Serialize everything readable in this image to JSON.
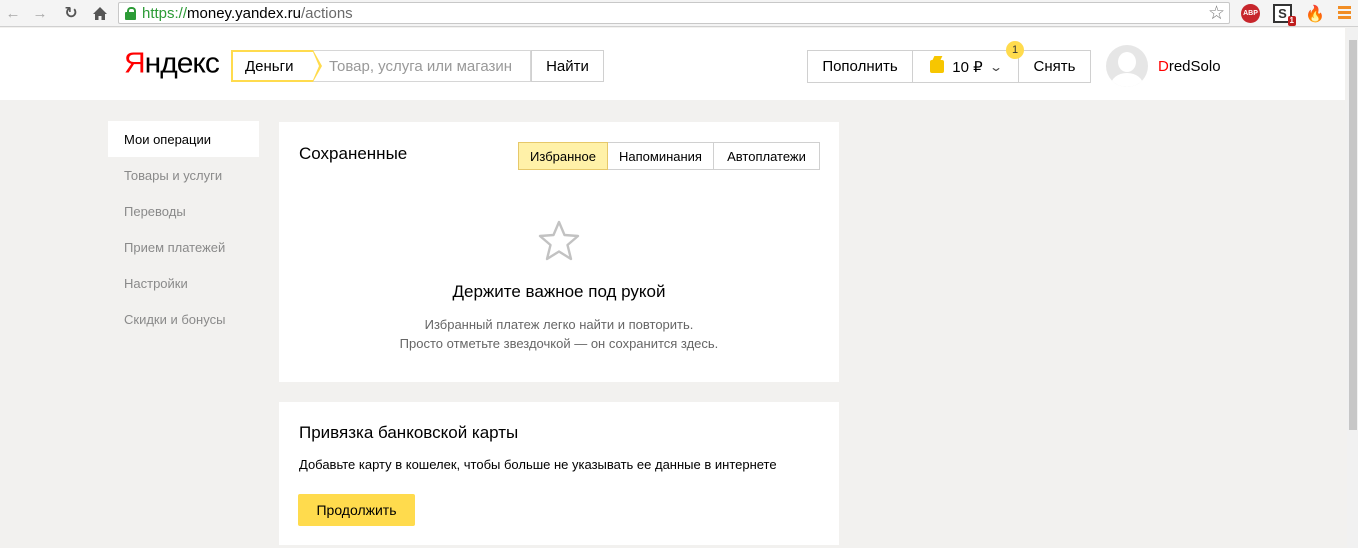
{
  "browser": {
    "url_scheme": "https://",
    "url_host": "money.yandex.ru",
    "url_path": "/actions",
    "ext_badge": "1",
    "abp_label": "ABP",
    "s_label": "S"
  },
  "header": {
    "logo_first": "Я",
    "logo_rest": "ндекс",
    "service_tab": "Деньги",
    "search_placeholder": "Товар, услуга или магазин",
    "search_button": "Найти",
    "topup_button": "Пополнить",
    "balance": "10 ₽",
    "withdraw_button": "Снять",
    "notification_count": "1",
    "username_first": "D",
    "username_rest": "redSolo"
  },
  "sidebar": {
    "items": [
      {
        "label": "Мои операции"
      },
      {
        "label": "Товары и услуги"
      },
      {
        "label": "Переводы"
      },
      {
        "label": "Прием платежей"
      },
      {
        "label": "Настройки"
      },
      {
        "label": "Скидки и бонусы"
      }
    ]
  },
  "saved": {
    "title": "Сохраненные",
    "tabs": [
      {
        "label": "Избранное"
      },
      {
        "label": "Напоминания"
      },
      {
        "label": "Автоплатежи"
      }
    ],
    "empty_title": "Держите важное под рукой",
    "empty_line1": "Избранный платеж легко найти и повторить.",
    "empty_line2": "Просто отметьте звездочкой — он сохранится здесь."
  },
  "bank_card": {
    "title": "Привязка банковской карты",
    "text": "Добавьте карту в кошелек, чтобы больше не указывать ее данные в интернете",
    "button": "Продолжить"
  },
  "colors": {
    "accent_yellow": "#ffdb4d",
    "tab_active_bg": "#fff1a8",
    "logo_red": "#ff0000",
    "url_green": "#2c9b36"
  }
}
